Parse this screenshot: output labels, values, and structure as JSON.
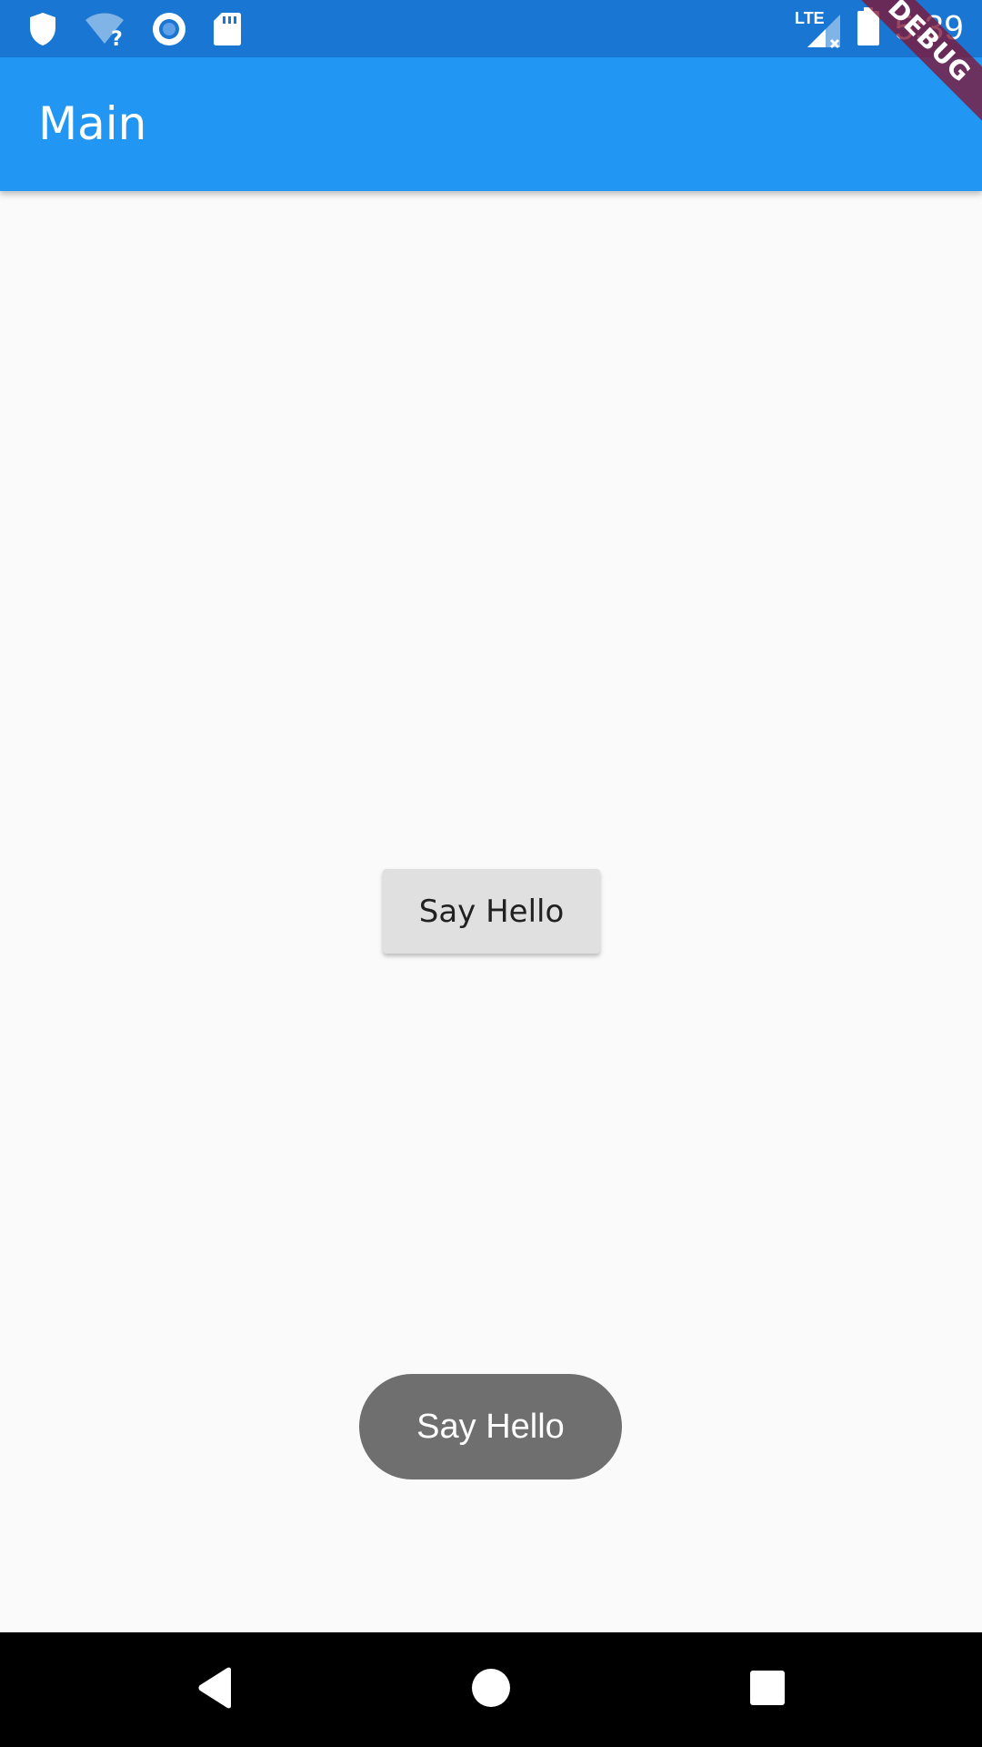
{
  "status_bar": {
    "time": "5:39",
    "network_label": "LTE",
    "icons": [
      "shield-icon",
      "wifi-unknown-icon",
      "sync-circle-icon",
      "sd-card-icon",
      "lte-signal-icon",
      "battery-icon"
    ]
  },
  "app_bar": {
    "title": "Main",
    "color": "#2196f3"
  },
  "debug_banner": {
    "label": "DEBUG"
  },
  "main": {
    "say_hello_button_label": "Say Hello"
  },
  "toast": {
    "message": "Say Hello"
  },
  "nav_bar": {
    "icons": [
      "back-icon",
      "home-icon",
      "recents-icon"
    ]
  },
  "colors": {
    "status_bar": "#1976d2",
    "app_bar": "#2196f3",
    "background": "#fafafa",
    "button": "#e0e0e0",
    "toast": "#6f6f6f",
    "debug_banner": "#801434"
  }
}
